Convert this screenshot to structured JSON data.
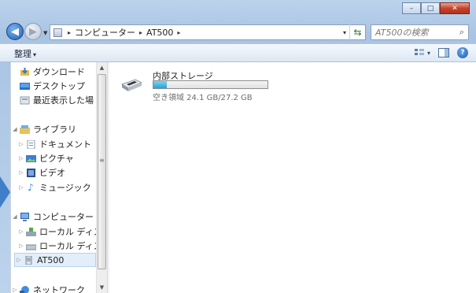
{
  "window": {
    "caption_buttons": {
      "minimize": "–",
      "maximize": "□",
      "close": "✕"
    }
  },
  "address": {
    "crumbs": [
      "コンピューター",
      "AT500"
    ],
    "separator": "▸",
    "dropdown": "▾"
  },
  "search": {
    "placeholder": "AT500の検索",
    "icon": "search-icon"
  },
  "toolbar": {
    "organize_label": "整理",
    "organize_arrow": "▾",
    "view_arrow": "▾",
    "help": "?"
  },
  "nav": {
    "favorites": [
      {
        "label": "ダウンロード",
        "icon": "downloads-icon"
      },
      {
        "label": "デスクトップ",
        "icon": "desktop-icon"
      },
      {
        "label": "最近表示した場",
        "icon": "recent-places-icon"
      }
    ],
    "libraries": {
      "label": "ライブラリ",
      "icon": "library-icon",
      "items": [
        {
          "label": "ドキュメント",
          "icon": "documents-icon"
        },
        {
          "label": "ピクチャ",
          "icon": "pictures-icon"
        },
        {
          "label": "ビデオ",
          "icon": "videos-icon"
        },
        {
          "label": "ミュージック",
          "icon": "music-icon"
        }
      ]
    },
    "computer": {
      "label": "コンピューター",
      "icon": "computer-icon",
      "items": [
        {
          "label": "ローカル ディス",
          "icon": "system-disk-icon"
        },
        {
          "label": "ローカル ディス",
          "icon": "local-disk-icon"
        },
        {
          "label": "AT500",
          "icon": "device-icon",
          "selected": true
        }
      ]
    },
    "network": {
      "label": "ネットワーク",
      "icon": "network-icon"
    }
  },
  "content": {
    "drive": {
      "name": "内部ストレージ",
      "free_text": "空き領域 24.1 GB/27.2 GB",
      "free_gb": 24.1,
      "total_gb": 27.2,
      "used_fraction": 0.114,
      "icon": "portable-device-icon"
    }
  },
  "colors": {
    "accent": "#26a0da",
    "frame": "#bcd3ec",
    "selection": "#e3eefb",
    "close_button": "#c6432b"
  }
}
